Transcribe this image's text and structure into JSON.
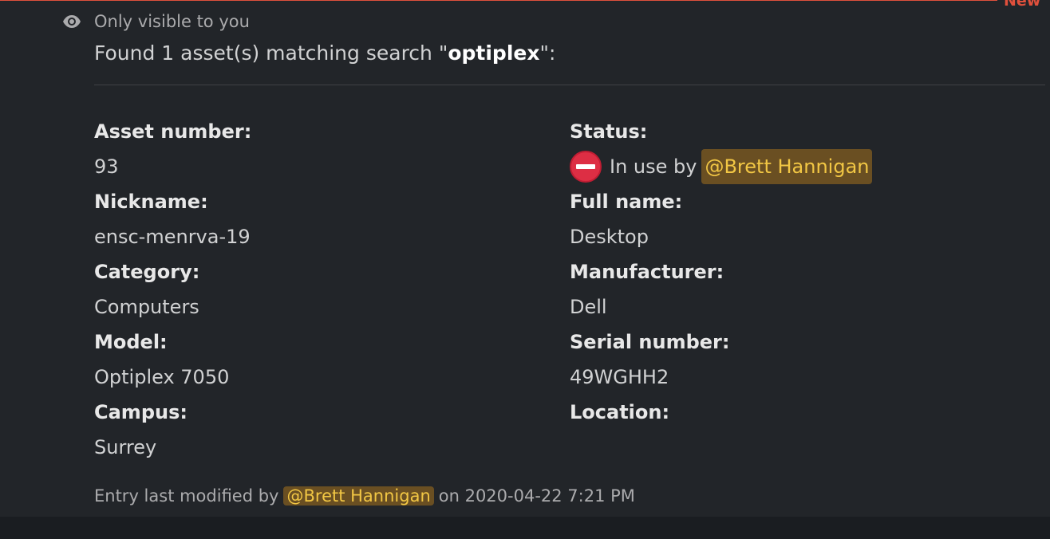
{
  "divider": {
    "label": "New"
  },
  "ephemeral_notice": {
    "icon": "eye-icon",
    "text": "Only visible to you"
  },
  "headline": {
    "prefix": "Found 1 asset(s) matching search \"",
    "query": "optiplex",
    "suffix": "\":"
  },
  "fields": {
    "asset_number": {
      "label": "Asset number:",
      "value": "93"
    },
    "status": {
      "label": "Status:",
      "icon": "no-entry-icon",
      "text": "In use by",
      "mention": "@Brett Hannigan"
    },
    "nickname": {
      "label": "Nickname:",
      "value": "ensc-menrva-19"
    },
    "full_name": {
      "label": "Full name:",
      "value": "Desktop"
    },
    "category": {
      "label": "Category:",
      "value": "Computers"
    },
    "manufacturer": {
      "label": "Manufacturer:",
      "value": "Dell"
    },
    "model": {
      "label": "Model:",
      "value": "Optiplex 7050"
    },
    "serial_number": {
      "label": "Serial number:",
      "value": "49WGHH2"
    },
    "campus": {
      "label": "Campus:",
      "value": "Surrey"
    },
    "location": {
      "label": "Location:",
      "value": ""
    }
  },
  "footer": {
    "prefix": "Entry last modified by",
    "mention": "@Brett Hannigan",
    "suffix": "on 2020-04-22 7:21 PM"
  },
  "colors": {
    "background": "#222529",
    "mention_bg": "#6a4f22",
    "mention_text": "#f2c744",
    "new_divider": "#e0503c"
  }
}
